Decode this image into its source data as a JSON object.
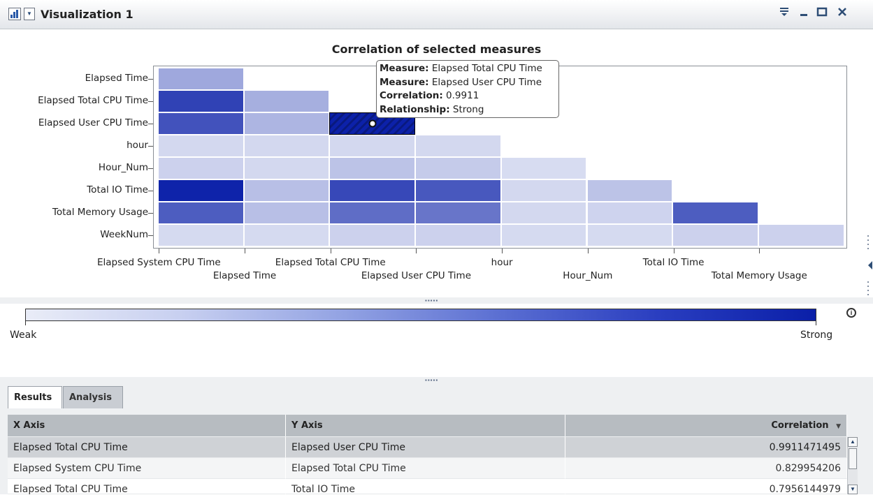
{
  "window": {
    "title": "Visualization 1",
    "controls": [
      "menu",
      "minimize",
      "maximize",
      "close"
    ]
  },
  "chart": {
    "title": "Correlation of selected measures",
    "tooltip": {
      "measure1_label": "Measure:",
      "measure1_value": " Elapsed Total CPU Time",
      "measure2_label": "Measure:",
      "measure2_value": " Elapsed User CPU Time",
      "correlation_label": "Correlation:",
      "correlation_value": " 0.9911",
      "relationship_label": "Relationship:",
      "relationship_value": " Strong"
    }
  },
  "chart_data": {
    "type": "heatmap",
    "title": "Correlation of selected measures",
    "y_categories": [
      "Elapsed Time",
      "Elapsed Total CPU Time",
      "Elapsed User CPU Time",
      "hour",
      "Hour_Num",
      "Total IO Time",
      "Total Memory Usage",
      "WeekNum"
    ],
    "x_categories": [
      "Elapsed System CPU Time",
      "Elapsed Time",
      "Elapsed Total CPU Time",
      "Elapsed User CPU Time",
      "hour",
      "Hour_Num",
      "Total IO Time",
      "Total Memory Usage"
    ],
    "values": [
      [
        0.33,
        null,
        null,
        null,
        null,
        null,
        null,
        null
      ],
      [
        0.83,
        0.3,
        null,
        null,
        null,
        null,
        null,
        null
      ],
      [
        0.75,
        0.27,
        0.99,
        null,
        null,
        null,
        null,
        null
      ],
      [
        0.1,
        0.1,
        0.1,
        0.1,
        null,
        null,
        null,
        null
      ],
      [
        0.13,
        0.1,
        0.2,
        0.16,
        0.08,
        null,
        null,
        null
      ],
      [
        0.98,
        0.22,
        0.8,
        0.72,
        0.1,
        0.2,
        null,
        null
      ],
      [
        0.7,
        0.22,
        0.62,
        0.58,
        0.1,
        0.12,
        0.7,
        null
      ],
      [
        0.09,
        0.09,
        0.13,
        0.13,
        0.09,
        0.09,
        0.13,
        0.13
      ]
    ],
    "selected": {
      "row": 2,
      "col": 2
    },
    "scale": {
      "min_label": "Weak",
      "max_label": "Strong"
    }
  },
  "legend": {
    "weak": "Weak",
    "strong": "Strong"
  },
  "tabs": {
    "results": "Results",
    "analysis": "Analysis"
  },
  "table": {
    "headers": {
      "x": "X Axis",
      "y": "Y Axis",
      "corr": "Correlation"
    },
    "rows": [
      {
        "x": "Elapsed Total CPU Time",
        "y": "Elapsed User CPU Time",
        "corr": "0.9911471495"
      },
      {
        "x": "Elapsed System CPU Time",
        "y": "Elapsed Total CPU Time",
        "corr": "0.829954206"
      },
      {
        "x": "Elapsed Total CPU Time",
        "y": "Total IO Time",
        "corr": "0.7956144979"
      }
    ]
  }
}
